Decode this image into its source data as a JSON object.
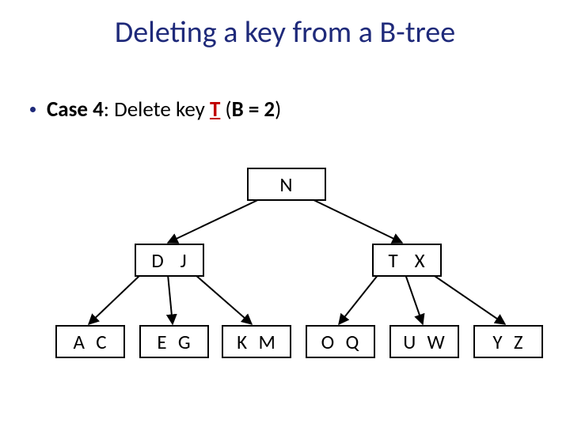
{
  "title": "Deleting a key from a B-tree",
  "bullet": {
    "case_label": "Case 4",
    "separator": ": ",
    "delete_text": "Delete key ",
    "key": "T",
    "space_after_key": "  (",
    "condition": "B = 2",
    "close": ")"
  },
  "tree": {
    "root": {
      "keys": "N"
    },
    "mid_left": {
      "keys": "D   J"
    },
    "mid_right": {
      "keys": "T   X"
    },
    "leaves": [
      {
        "keys": "A  C"
      },
      {
        "keys": "E  G"
      },
      {
        "keys": "K  M"
      },
      {
        "keys": "O  Q"
      },
      {
        "keys": "U  W"
      },
      {
        "keys": "Y  Z"
      }
    ]
  },
  "chart_data": {
    "type": "tree",
    "title": "B-tree before deleting key T (B = 2)",
    "root": {
      "keys": [
        "N"
      ],
      "children": [
        {
          "keys": [
            "D",
            "J"
          ],
          "children": [
            {
              "keys": [
                "A",
                "C"
              ]
            },
            {
              "keys": [
                "E",
                "G"
              ]
            },
            {
              "keys": [
                "K",
                "M"
              ]
            }
          ]
        },
        {
          "keys": [
            "T",
            "X"
          ],
          "children": [
            {
              "keys": [
                "O",
                "Q"
              ]
            },
            {
              "keys": [
                "U",
                "W"
              ]
            },
            {
              "keys": [
                "Y",
                "Z"
              ]
            }
          ]
        }
      ]
    },
    "delete_key": "T",
    "B": 2
  }
}
